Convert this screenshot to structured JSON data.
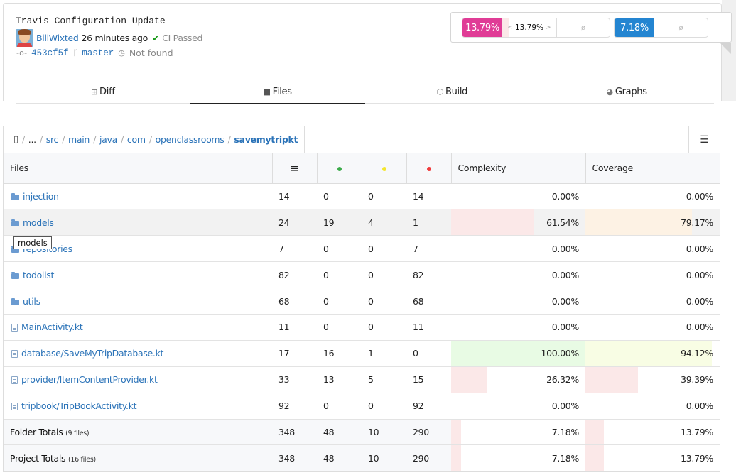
{
  "commit": {
    "title": "Travis Configuration Update",
    "author": "BillWixted",
    "time": "26 minutes ago",
    "ci_status": "CI Passed",
    "sha": "453cf5f",
    "branch": "master",
    "pr_status": "Not found"
  },
  "coverage_badges": {
    "coverage_value": "13.79%",
    "coverage_diff": "13.79%",
    "coverage_diff_left_arrow": "<",
    "coverage_diff_right_arrow": ">",
    "coverage_null": "ø",
    "complexity_value": "7.18%",
    "complexity_null": "ø",
    "colors": {
      "coverage": "#e03c96",
      "complexity": "#2485d1"
    }
  },
  "tabs": [
    {
      "label": "Diff",
      "icon": "diff-icon",
      "active": false
    },
    {
      "label": "Files",
      "icon": "folder-icon",
      "active": true
    },
    {
      "label": "Build",
      "icon": "box-icon",
      "active": false
    },
    {
      "label": "Graphs",
      "icon": "pie-chart-icon",
      "active": false
    }
  ],
  "breadcrumb": {
    "items": [
      "...",
      "src",
      "main",
      "java",
      "com",
      "openclassrooms"
    ],
    "current": "savemytripkt",
    "separator": "/"
  },
  "table": {
    "headers": {
      "files": "Files",
      "complexity": "Complexity",
      "coverage": "Coverage"
    },
    "rows": [
      {
        "type": "folder",
        "name": "injection",
        "lines": "14",
        "hit": "0",
        "partial": "0",
        "miss": "14",
        "complexity": "0.00%",
        "coverage": "0.00%",
        "complexity_ratio": 0,
        "coverage_ratio": 0
      },
      {
        "type": "folder",
        "name": "models",
        "lines": "24",
        "hit": "19",
        "partial": "4",
        "miss": "1",
        "complexity": "61.54%",
        "coverage": "79.17%",
        "complexity_ratio": 0.6154,
        "coverage_ratio": 0.7917
      },
      {
        "type": "folder",
        "name": "repositories",
        "lines": "7",
        "hit": "0",
        "partial": "0",
        "miss": "7",
        "complexity": "0.00%",
        "coverage": "0.00%",
        "complexity_ratio": 0,
        "coverage_ratio": 0
      },
      {
        "type": "folder",
        "name": "todolist",
        "lines": "82",
        "hit": "0",
        "partial": "0",
        "miss": "82",
        "complexity": "0.00%",
        "coverage": "0.00%",
        "complexity_ratio": 0,
        "coverage_ratio": 0
      },
      {
        "type": "folder",
        "name": "utils",
        "lines": "68",
        "hit": "0",
        "partial": "0",
        "miss": "68",
        "complexity": "0.00%",
        "coverage": "0.00%",
        "complexity_ratio": 0,
        "coverage_ratio": 0
      },
      {
        "type": "file",
        "name": "MainActivity.kt",
        "lines": "11",
        "hit": "0",
        "partial": "0",
        "miss": "11",
        "complexity": "0.00%",
        "coverage": "0.00%",
        "complexity_ratio": 0,
        "coverage_ratio": 0
      },
      {
        "type": "file",
        "name": "database/SaveMyTripDatabase.kt",
        "lines": "17",
        "hit": "16",
        "partial": "1",
        "miss": "0",
        "complexity": "100.00%",
        "coverage": "94.12%",
        "complexity_ratio": 1.0,
        "coverage_ratio": 0.9412
      },
      {
        "type": "file",
        "name": "provider/ItemContentProvider.kt",
        "lines": "33",
        "hit": "13",
        "partial": "5",
        "miss": "15",
        "complexity": "26.32%",
        "coverage": "39.39%",
        "complexity_ratio": 0.2632,
        "coverage_ratio": 0.3939
      },
      {
        "type": "file",
        "name": "tripbook/TripBookActivity.kt",
        "lines": "92",
        "hit": "0",
        "partial": "0",
        "miss": "92",
        "complexity": "0.00%",
        "coverage": "0.00%",
        "complexity_ratio": 0,
        "coverage_ratio": 0
      }
    ],
    "totals": [
      {
        "label": "Folder Totals",
        "sub": "(9 files)",
        "lines": "348",
        "hit": "48",
        "partial": "10",
        "miss": "290",
        "complexity": "7.18%",
        "coverage": "13.79%",
        "complexity_ratio": 0.0718,
        "coverage_ratio": 0.1379
      },
      {
        "label": "Project Totals",
        "sub": "(16 files)",
        "lines": "348",
        "hit": "48",
        "partial": "10",
        "miss": "290",
        "complexity": "7.18%",
        "coverage": "13.79%",
        "complexity_ratio": 0.0718,
        "coverage_ratio": 0.1379
      }
    ]
  },
  "tooltip": "models"
}
